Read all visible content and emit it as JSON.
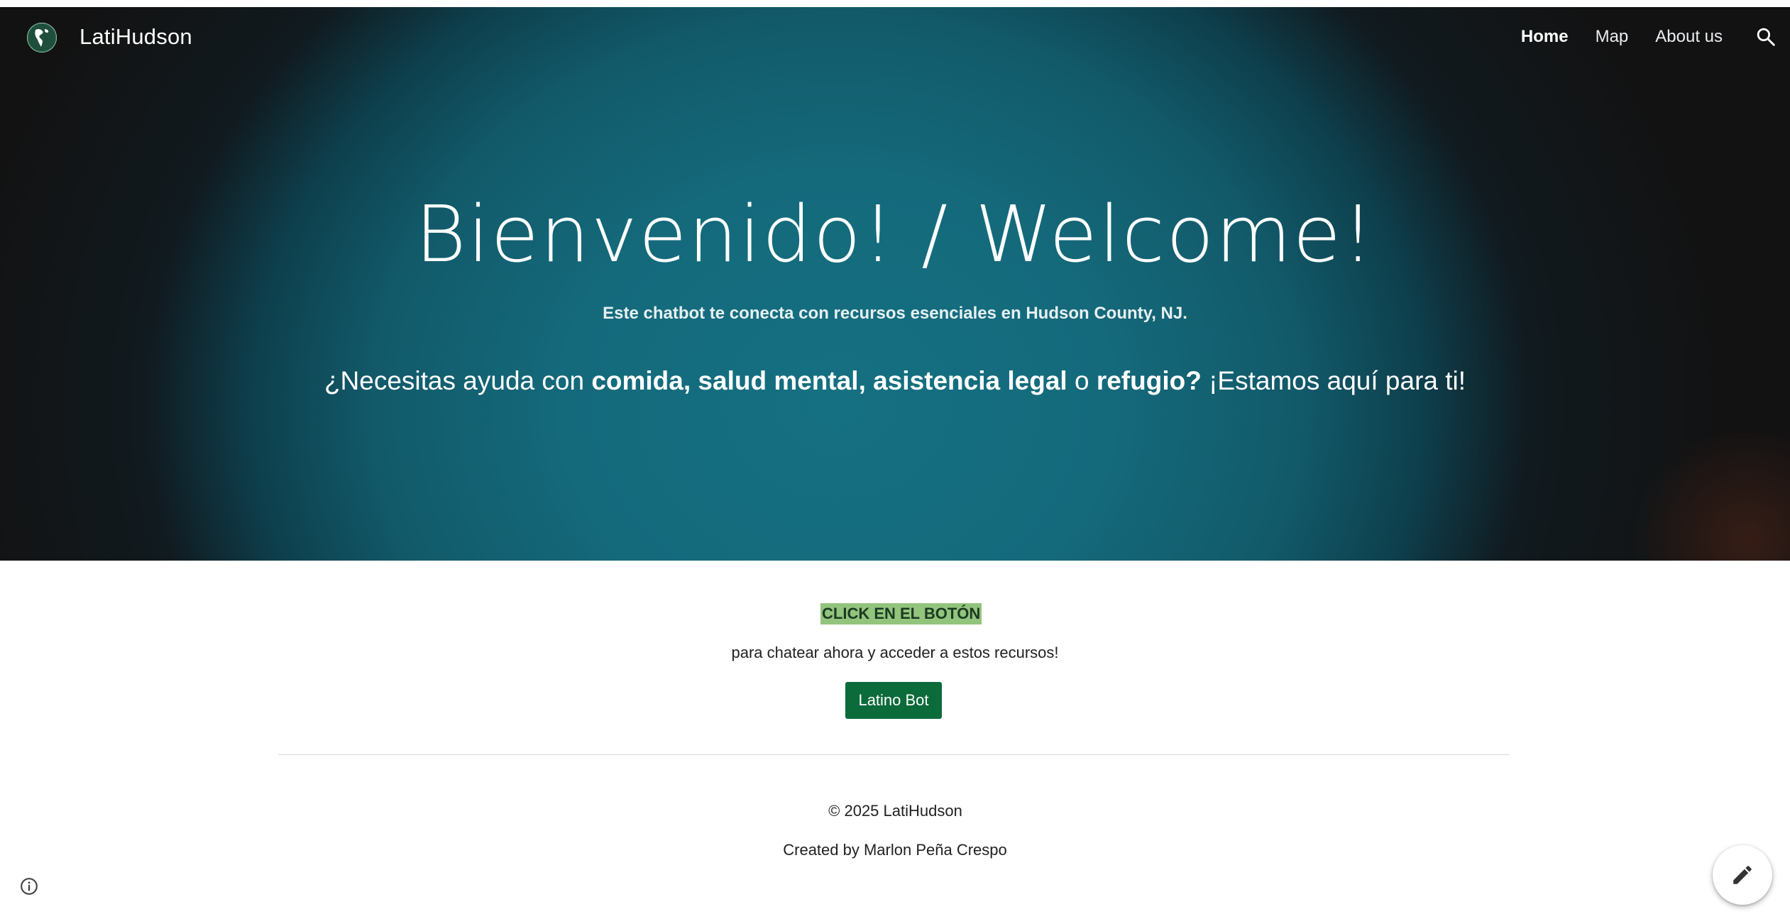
{
  "header": {
    "site_title": "LatiHudson",
    "nav": [
      {
        "label": "Home",
        "active": true
      },
      {
        "label": "Map",
        "active": false
      },
      {
        "label": "About us",
        "active": false
      }
    ],
    "search_icon": "search-icon",
    "logo_icon": "globe-americas-logo"
  },
  "hero": {
    "title": "Bienvenido! / Welcome!",
    "subtitle": "Este chatbot te conecta con recursos esenciales en Hudson County, NJ.",
    "line": {
      "prefix": "¿Necesitas ayuda con ",
      "bold1": "comida, salud mental, asistencia legal",
      "mid": " o ",
      "bold2": "refugio?",
      "suffix": " ¡Estamos aquí para ti!"
    },
    "colors": {
      "teal": "#157082",
      "dark": "#121212"
    }
  },
  "main": {
    "cta_highlight": "CLICK EN EL BOTÓN",
    "cta_text": "para chatear ahora y acceder a estos recursos!",
    "button_label": "Latino Bot",
    "button_color": "#0b6b3a",
    "highlight_color": "#93c47d"
  },
  "footer": {
    "copyright": "© 2025 LatiHudson",
    "credit": "Created by Marlon Peña Crespo"
  },
  "widgets": {
    "info_icon": "info-icon",
    "edit_icon": "pencil-icon"
  }
}
